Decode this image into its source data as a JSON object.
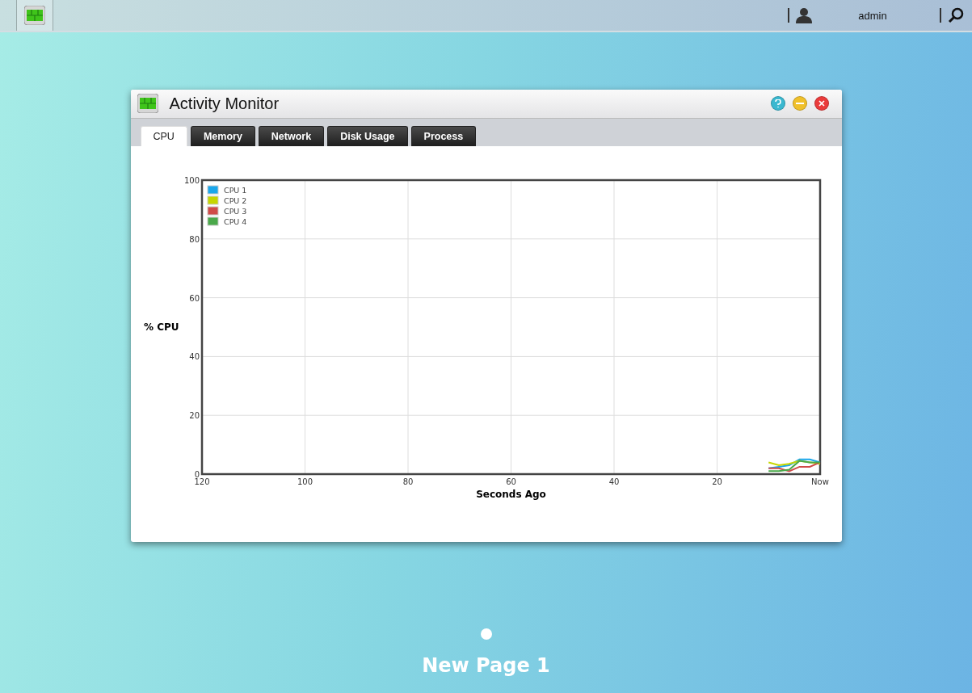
{
  "top_bar": {
    "user": "admin"
  },
  "window": {
    "title": "Activity Monitor",
    "tabs": [
      {
        "label": "CPU",
        "selected": true
      },
      {
        "label": "Memory",
        "selected": false
      },
      {
        "label": "Network",
        "selected": false
      },
      {
        "label": "Disk Usage",
        "selected": false
      },
      {
        "label": "Process",
        "selected": false
      }
    ],
    "chart_data": {
      "type": "line",
      "xlabel": "Seconds Ago",
      "ylabel": "% CPU",
      "x": [
        10,
        8,
        6,
        4,
        2,
        0
      ],
      "series": [
        {
          "name": "CPU 1",
          "color": "#1aa7ec",
          "values": [
            2,
            2.5,
            3,
            5,
            5,
            4
          ]
        },
        {
          "name": "CPU 2",
          "color": "#c6d600",
          "values": [
            4,
            3,
            3.5,
            4.5,
            4,
            3.5
          ]
        },
        {
          "name": "CPU 3",
          "color": "#d04a48",
          "values": [
            2,
            2,
            1,
            2.5,
            2.5,
            4
          ]
        },
        {
          "name": "CPU 4",
          "color": "#4aa84a",
          "values": [
            1,
            1,
            1.5,
            4.5,
            4,
            4
          ]
        }
      ],
      "xlim": [
        120,
        0
      ],
      "ylim": [
        0,
        100
      ],
      "grid": true,
      "legend": true,
      "xticks": [
        120,
        100,
        80,
        60,
        40,
        20,
        {
          "value": 0,
          "label": "Now"
        }
      ],
      "yticks": [
        0,
        20,
        40,
        60,
        80,
        100
      ]
    }
  },
  "desktop": {
    "page_label": "New Page 1"
  }
}
